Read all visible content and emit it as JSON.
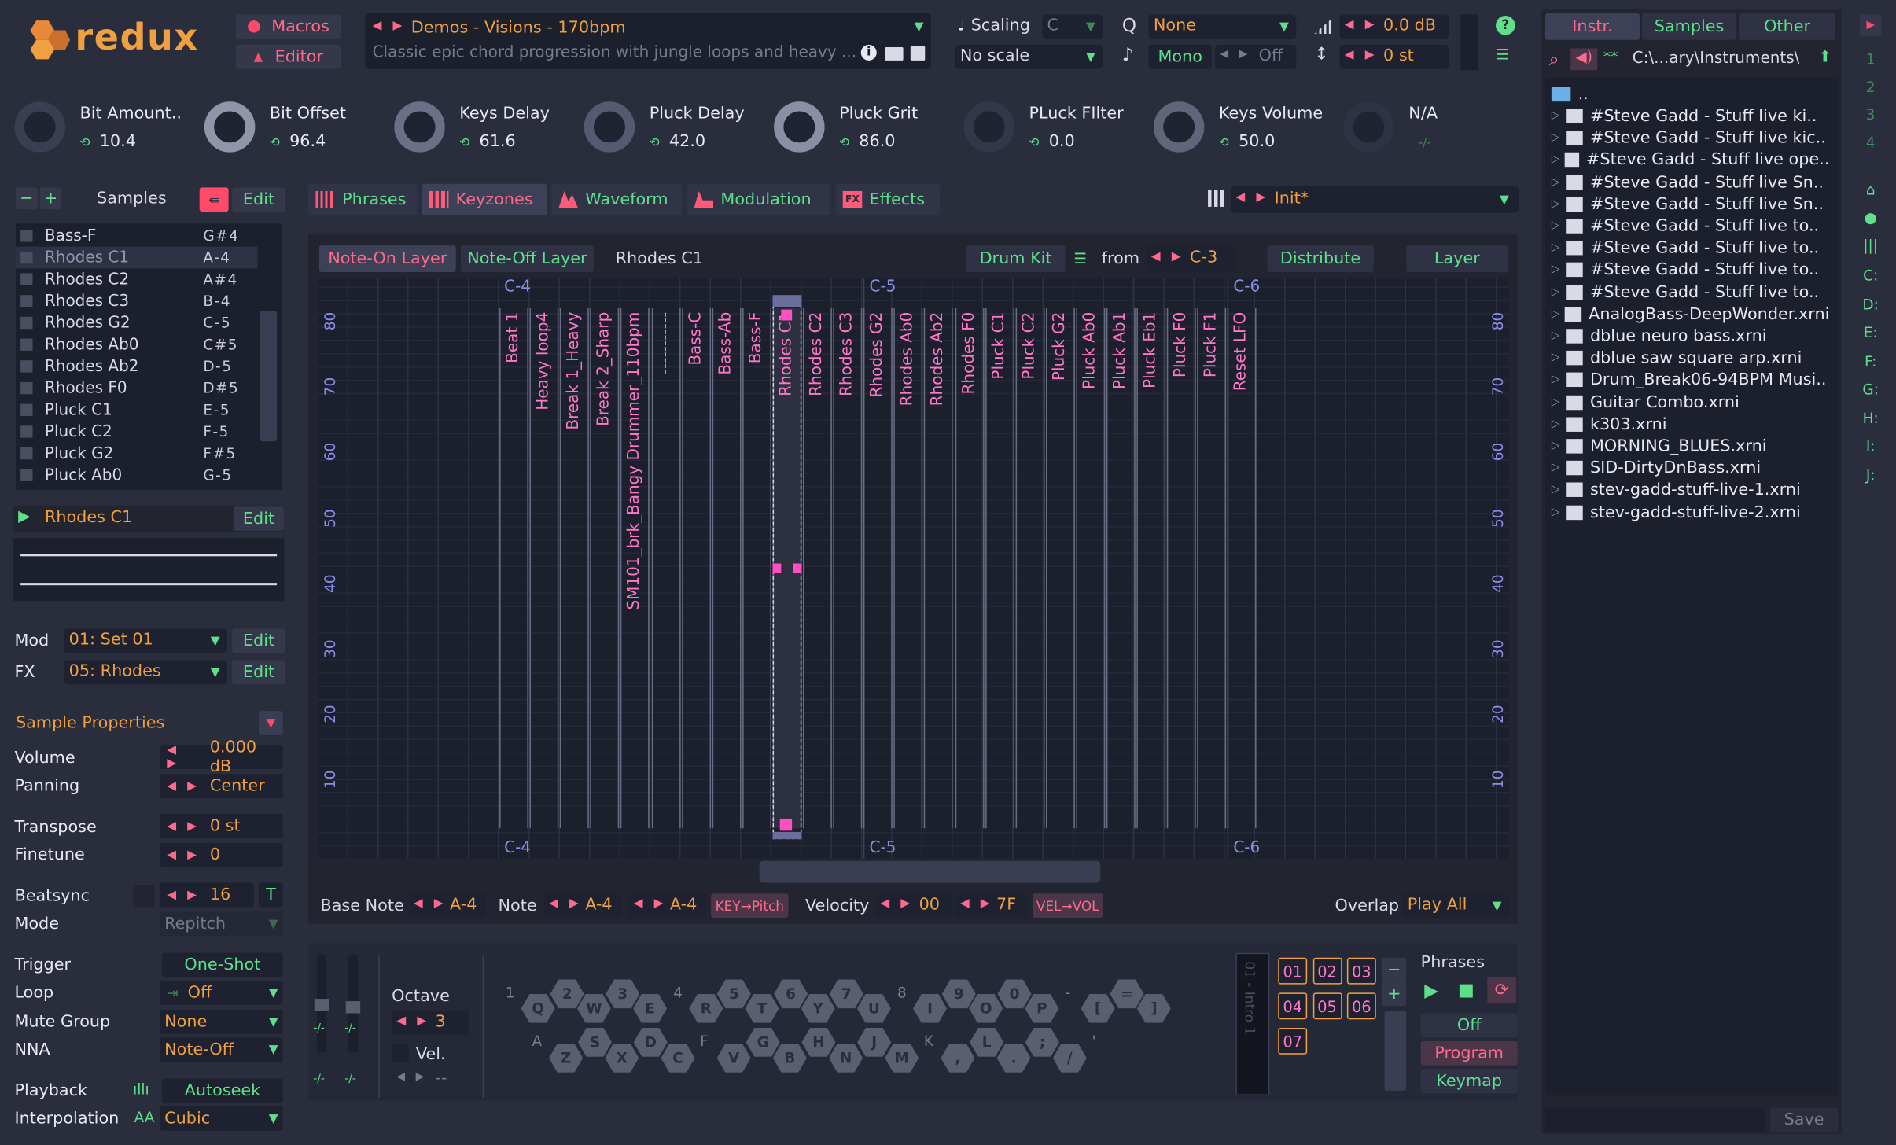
{
  "header": {
    "logo": "redux",
    "macros": "Macros",
    "editor": "Editor",
    "preset_title": "Demos - Visions - 170bpm",
    "preset_desc": "Classic epic chord progression with jungle loops and heavy ...",
    "scaling_label": "Scaling",
    "scaling_key": "C",
    "scale": "No scale",
    "quantize": "None",
    "mono": "Mono",
    "mono_state": "Off",
    "volume": "0.0 dB",
    "transpose": "0 st"
  },
  "knobs": [
    {
      "name": "Bit Amount..",
      "value": "10.4"
    },
    {
      "name": "Bit Offset",
      "value": "96.4"
    },
    {
      "name": "Keys Delay",
      "value": "61.6"
    },
    {
      "name": "Pluck Delay",
      "value": "42.0"
    },
    {
      "name": "Pluck Grit",
      "value": "86.0"
    },
    {
      "name": "PLuck FIlter",
      "value": "0.0"
    },
    {
      "name": "Keys Volume",
      "value": "50.0"
    },
    {
      "name": "N/A",
      "value": "-/-"
    }
  ],
  "samples_panel": {
    "title": "Samples",
    "edit": "Edit",
    "items": [
      {
        "name": "Bass-F",
        "note": "G#4"
      },
      {
        "name": "Rhodes C1",
        "note": "A-4"
      },
      {
        "name": "Rhodes C2",
        "note": "A#4"
      },
      {
        "name": "Rhodes C3",
        "note": "B-4"
      },
      {
        "name": "Rhodes  G2",
        "note": "C-5"
      },
      {
        "name": "Rhodes Ab0",
        "note": "C#5"
      },
      {
        "name": "Rhodes  Ab2",
        "note": "D-5"
      },
      {
        "name": "Rhodes F0",
        "note": "D#5"
      },
      {
        "name": "Pluck C1",
        "note": "E-5"
      },
      {
        "name": "Pluck C2",
        "note": "F-5"
      },
      {
        "name": "Pluck G2",
        "note": "F#5"
      },
      {
        "name": "Pluck Ab0",
        "note": "G-5"
      }
    ],
    "selected": "Rhodes C1",
    "selected_edit": "Edit",
    "mod_label": "Mod",
    "mod_value": "01: Set 01",
    "mod_edit": "Edit",
    "fx_label": "FX",
    "fx_value": "05: Rhodes",
    "fx_edit": "Edit"
  },
  "props": {
    "title": "Sample Properties",
    "volume_l": "Volume",
    "volume": "0.000 dB",
    "panning_l": "Panning",
    "panning": "Center",
    "transpose_l": "Transpose",
    "transpose": "0 st",
    "finetune_l": "Finetune",
    "finetune": "0",
    "beatsync_l": "Beatsync",
    "beatsync": "16",
    "beatsync_t": "T",
    "mode_l": "Mode",
    "mode": "Repitch",
    "trigger_l": "Trigger",
    "trigger": "One-Shot",
    "loop_l": "Loop",
    "loop": "Off",
    "mute_l": "Mute Group",
    "mute": "None",
    "nna_l": "NNA",
    "nna": "Note-Off",
    "playback_l": "Playback",
    "playback": "Autoseek",
    "interp_l": "Interpolation",
    "interp": "Cubic"
  },
  "tabs": [
    "Phrases",
    "Keyzones",
    "Waveform",
    "Modulation",
    "Effects"
  ],
  "preset_slot": "Init*",
  "keyzones": {
    "note_on": "Note-On Layer",
    "note_off": "Note-Off Layer",
    "current": "Rhodes C1",
    "drum_kit": "Drum Kit",
    "from": "from",
    "from_note": "C-3",
    "distribute": "Distribute",
    "layer": "Layer",
    "octaves": [
      "C-4",
      "C-5",
      "C-6"
    ],
    "vel_ticks": [
      "80",
      "70",
      "60",
      "50",
      "40",
      "30",
      "20",
      "10"
    ],
    "zones": [
      "Beat 1",
      "Heavy loop4",
      "Break 1_Heavy",
      "Break 2_Sharp",
      "SM101_brk_Bangy Drummer_110bpm",
      "-----------",
      "Bass-C",
      "Bass-Ab",
      "Bass-F",
      "Rhodes C1",
      "Rhodes C2",
      "Rhodes C3",
      "Rhodes  G2",
      "Rhodes Ab0",
      "Rhodes  Ab2",
      "Rhodes F0",
      "Pluck C1",
      "Pluck C2",
      "Pluck G2",
      "Pluck Ab0",
      "Pluck Ab1",
      "Pluck Eb1",
      "Pluck F0",
      "Pluck F1",
      "Reset LFO"
    ],
    "base_note_l": "Base Note",
    "base_note": "A-4",
    "note_l": "Note",
    "note_lo": "A-4",
    "note_hi": "A-4",
    "key_pitch": "KEY→Pitch",
    "velocity_l": "Velocity",
    "vel_lo": "00",
    "vel_hi": "7F",
    "vel_vol": "VEL→VOL",
    "overlap_l": "Overlap",
    "overlap": "Play All"
  },
  "keyboard": {
    "octave_l": "Octave",
    "octave": "3",
    "vel_l": "Vel.",
    "vel_val": "--",
    "top_nums": [
      "1",
      "2",
      "3",
      "4",
      "5",
      "6",
      "7",
      "8",
      "9",
      "0",
      "-",
      "="
    ],
    "row1": [
      "Q",
      "W",
      "E",
      "R",
      "T",
      "Y",
      "U",
      "I",
      "O",
      "P",
      "[",
      "]"
    ],
    "row2": [
      "A",
      "S",
      "D",
      "F",
      "G",
      "H",
      "J",
      "K",
      "L",
      ";",
      "'"
    ],
    "row3": [
      "Z",
      "X",
      "C",
      "V",
      "B",
      "N",
      "M",
      ",",
      ".",
      "/"
    ]
  },
  "phrases": {
    "title": "Phrases",
    "slots": [
      "01",
      "02",
      "03",
      "04",
      "05",
      "06",
      "07"
    ],
    "lcd": "01 - Intro 1",
    "mode_off": "Off",
    "mode_program": "Program",
    "mode_keymap": "Keymap"
  },
  "browser": {
    "tabs": [
      "Instr.",
      "Samples",
      "Other"
    ],
    "path": "C:\\...ary\\Instruments\\",
    "parent": "..",
    "items": [
      "#Steve Gadd - Stuff live ki..",
      "#Steve Gadd - Stuff live kic..",
      "#Steve Gadd - Stuff live ope..",
      "#Steve Gadd - Stuff live Sn..",
      "#Steve Gadd - Stuff live Sn..",
      "#Steve Gadd - Stuff live to..",
      "#Steve Gadd - Stuff live to..",
      "#Steve Gadd - Stuff live to..",
      "#Steve Gadd - Stuff live to..",
      "AnalogBass-DeepWonder.xrni",
      "dblue neuro bass.xrni",
      "dblue saw square arp.xrni",
      "Drum_Break06-94BPM Musi..",
      "Guitar Combo.xrni",
      "k303.xrni",
      "MORNING_BLUES.xrni",
      "SID-DirtyDnBass.xrni",
      "stev-gadd-stuff-live-1.xrni",
      "stev-gadd-stuff-live-2.xrni"
    ],
    "save": "Save"
  },
  "side_nums": [
    "1",
    "2",
    "3",
    "4"
  ],
  "side_drives": [
    "C:",
    "D:",
    "E:",
    "F:",
    "G:",
    "H:",
    "I:",
    "J:"
  ],
  "colors": {
    "accent": "#f0a040",
    "green": "#5ee08a",
    "pink": "#ff77c8",
    "bg": "#2a2d3b"
  }
}
